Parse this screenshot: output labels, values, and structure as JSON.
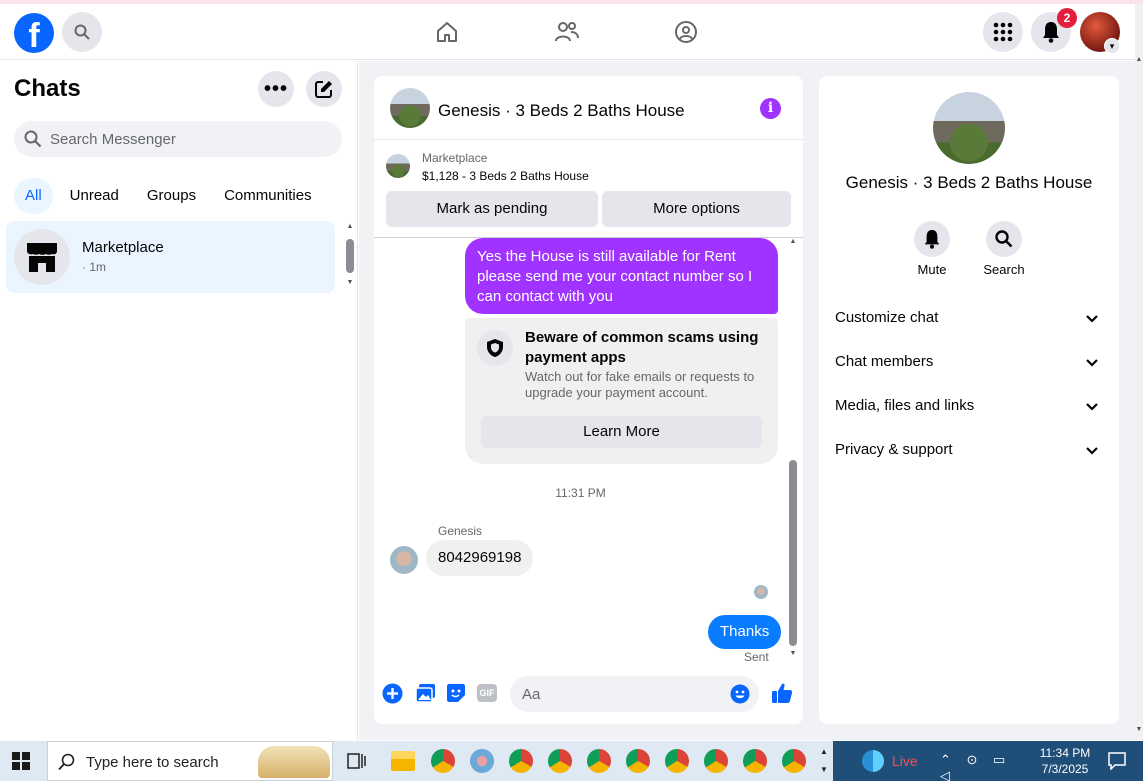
{
  "topbar": {
    "logo": "f",
    "notifications_badge": "2",
    "icons": [
      "search-icon",
      "home-icon",
      "friends-icon",
      "groups-icon",
      "menu-grid-icon",
      "bell-icon"
    ]
  },
  "sidebar": {
    "title": "Chats",
    "search_placeholder": "Search Messenger",
    "filters": [
      "All",
      "Unread",
      "Groups",
      "Communities"
    ],
    "active_filter": "All",
    "chats": [
      {
        "name": "Marketplace",
        "time": "· 1m"
      }
    ]
  },
  "conversation": {
    "title": "Genesis · 3 Beds 2 Baths House",
    "marketplace_label": "Marketplace",
    "listing": "$1,128 - 3 Beds 2 Baths House",
    "mark_pending_label": "Mark as pending",
    "more_options_label": "More options",
    "messages": {
      "outgoing_1": "Yes the House is still available for Rent please send me your contact number so I can contact with you",
      "scam_title": "Beware of common scams using payment apps",
      "scam_body": "Watch out for fake emails or requests to upgrade your payment account.",
      "learn_more": "Learn More",
      "time_separator": "11:31 PM",
      "sender_name": "Genesis",
      "incoming_1": "8042969198",
      "outgoing_2": "Thanks",
      "status": "Sent"
    },
    "composer_placeholder": "Aa"
  },
  "info_panel": {
    "title": "Genesis · 3 Beds 2 Baths House",
    "mute_label": "Mute",
    "search_label": "Search",
    "sections": [
      "Customize chat",
      "Chat members",
      "Media, files and links",
      "Privacy & support"
    ]
  },
  "taskbar": {
    "search_placeholder": "Type here to search",
    "live_label": "Live",
    "time": "11:34 PM",
    "date": "7/3/2025"
  },
  "colors": {
    "brand_blue": "#0866ff",
    "purple_bubble": "#a033ff",
    "blue_bubble": "#0a7cff",
    "badge_red": "#e41e3f"
  }
}
